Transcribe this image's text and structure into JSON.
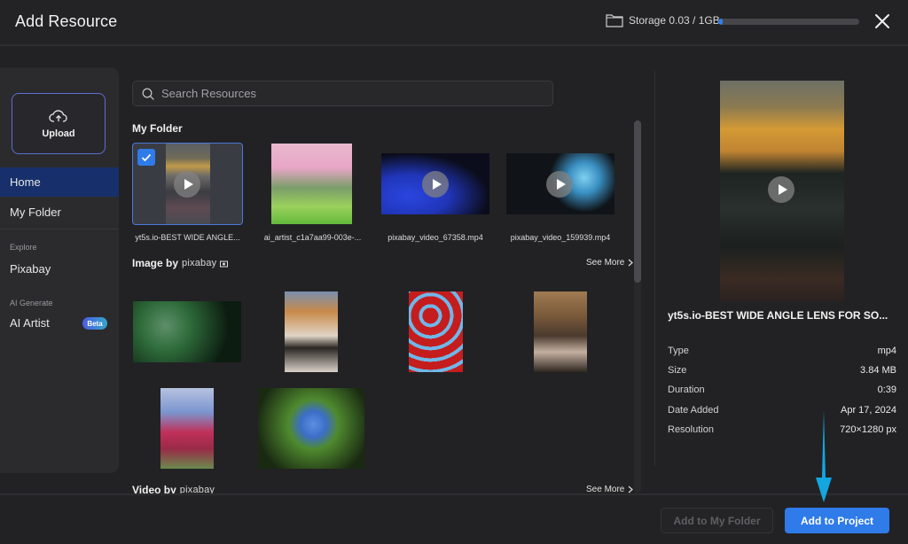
{
  "header": {
    "title": "Add Resource",
    "storage_label": "Storage 0.03 / 1GB",
    "storage_used_fraction": 0.03,
    "close_icon": "close-icon"
  },
  "sidebar": {
    "upload_label": "Upload",
    "items": [
      {
        "label": "Home",
        "active": true
      },
      {
        "label": "My Folder",
        "active": false
      }
    ],
    "sections": [
      {
        "title": "Explore",
        "items": [
          {
            "label": "Pixabay"
          }
        ]
      },
      {
        "title": "AI Generate",
        "items": [
          {
            "label": "AI Artist",
            "badge": "Beta"
          }
        ]
      }
    ]
  },
  "search": {
    "placeholder": "Search Resources",
    "value": ""
  },
  "my_folder": {
    "title": "My Folder",
    "items": [
      {
        "name": "yt5s.io-BEST WIDE ANGLE...",
        "type": "video",
        "selected": true
      },
      {
        "name": "ai_artist_c1a7aa99-003e-...",
        "type": "image",
        "selected": false
      },
      {
        "name": "pixabay_video_67358.mp4",
        "type": "video",
        "selected": false
      },
      {
        "name": "pixabay_video_159939.mp4",
        "type": "video",
        "selected": false
      }
    ]
  },
  "image_section": {
    "title": "Image by",
    "brand": "pixabay",
    "see_more": "See More",
    "items": [
      {
        "subject": "woman with green hair and plant"
      },
      {
        "subject": "tiger portrait"
      },
      {
        "subject": "red roses pattern"
      },
      {
        "subject": "owl"
      },
      {
        "subject": "pink tulips"
      },
      {
        "subject": "blue forget-me-not flowers"
      }
    ]
  },
  "video_section": {
    "title": "Video by",
    "brand": "pixabay",
    "see_more": "See More"
  },
  "details": {
    "name": "yt5s.io-BEST WIDE ANGLE LENS FOR SO...",
    "rows": [
      {
        "label": "Type",
        "value": "mp4"
      },
      {
        "label": "Size",
        "value": "3.84 MB"
      },
      {
        "label": "Duration",
        "value": "0:39"
      },
      {
        "label": "Date Added",
        "value": "Apr 17, 2024"
      },
      {
        "label": "Resolution",
        "value": "720×1280 px"
      }
    ]
  },
  "footer": {
    "add_to_folder": "Add to My Folder",
    "add_to_project": "Add to Project"
  },
  "colors": {
    "accent": "#2f7be9",
    "active_nav": "#17306b",
    "annotation_arrow": "#13a6e0"
  }
}
